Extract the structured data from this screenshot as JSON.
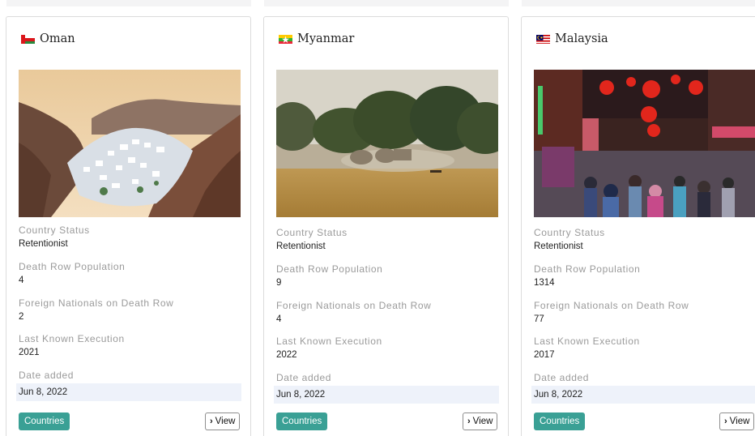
{
  "cards": [
    {
      "flag_icon": "oman-flag-icon",
      "country": "Oman",
      "fields": [
        {
          "label": "Country Status",
          "value": "Retentionist"
        },
        {
          "label": "Death Row Population",
          "value": "4"
        },
        {
          "label": "Foreign Nationals on Death Row",
          "value": "2"
        },
        {
          "label": "Last Known Execution",
          "value": "2021"
        }
      ],
      "date_label": "Date added",
      "date_value": "Jun 8, 2022",
      "tag_label": "Countries",
      "view_label": "View"
    },
    {
      "flag_icon": "myanmar-flag-icon",
      "country": "Myanmar",
      "fields": [
        {
          "label": "Country Status",
          "value": "Retentionist"
        },
        {
          "label": "Death Row Population",
          "value": "9"
        },
        {
          "label": "Foreign Nationals on Death Row",
          "value": "4"
        },
        {
          "label": "Last Known Execution",
          "value": "2022"
        }
      ],
      "date_label": "Date added",
      "date_value": "Jun 8, 2022",
      "tag_label": "Countries",
      "view_label": "View"
    },
    {
      "flag_icon": "malaysia-flag-icon",
      "country": "Malaysia",
      "fields": [
        {
          "label": "Country Status",
          "value": "Retentionist"
        },
        {
          "label": "Death Row Population",
          "value": "1314"
        },
        {
          "label": "Foreign Nationals on Death Row",
          "value": "77"
        },
        {
          "label": "Last Known Execution",
          "value": "2017"
        }
      ],
      "date_label": "Date added",
      "date_value": "Jun 8, 2022",
      "tag_label": "Countries",
      "view_label": "View"
    }
  ],
  "colors": {
    "tag_bg": "#3aa095",
    "date_row_bg": "#eef2fa",
    "label_gray": "#9a9a9a"
  }
}
